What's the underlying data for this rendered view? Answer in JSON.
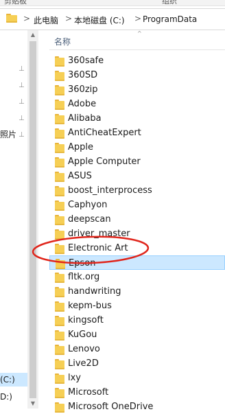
{
  "ribbon": {
    "left_label": "剪贴板",
    "right_label": "组织"
  },
  "breadcrumb": {
    "items": [
      "此电脑",
      "本地磁盘 (C:)",
      "ProgramData"
    ],
    "separator": ">"
  },
  "nav_pane": {
    "partial_labels": [
      "照片",
      "(C:)",
      "D:)"
    ]
  },
  "list": {
    "column_name": "名称",
    "sort_indicator": "^",
    "selected_index": 14,
    "items": [
      "360safe",
      "360SD",
      "360zip",
      "Adobe",
      "Alibaba",
      "AntiCheatExpert",
      "Apple",
      "Apple Computer",
      "ASUS",
      "boost_interprocess",
      "Caphyon",
      "deepscan",
      "driver_master",
      "Electronic Art",
      "Epson",
      "fltk.org",
      "handwriting",
      "kepm-bus",
      "kingsoft",
      "KuGou",
      "Lenovo",
      "Live2D",
      "lxy",
      "Microsoft",
      "Microsoft OneDrive"
    ]
  },
  "icons": {
    "folder": "folder-icon",
    "pin": "pin-icon",
    "chevron": "chevron-right-icon"
  },
  "colors": {
    "folder_yellow": "#f6cf55",
    "selection_bg": "#cce8ff",
    "selection_border": "#99d1ff",
    "annotation_red": "#e0251b"
  }
}
